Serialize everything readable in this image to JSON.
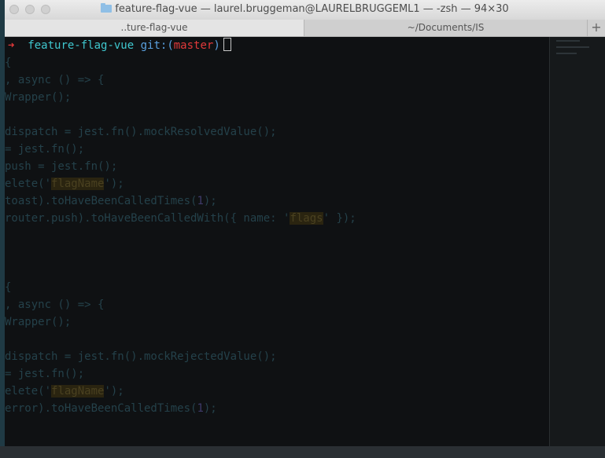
{
  "window": {
    "title": "feature-flag-vue — laurel.bruggeman@LAURELBRUGGEML1 — -zsh — 94×30",
    "tabs": [
      {
        "label": "..ture-flag-vue",
        "active": true
      },
      {
        "label": "~/Documents/IS",
        "active": false
      }
    ],
    "add_tab": "+"
  },
  "prompt": {
    "arrow": "➜",
    "directory": "feature-flag-vue",
    "git_label": "git:",
    "open_paren": "(",
    "branch": "master",
    "close_paren": ")"
  },
  "background_code": [
    [
      "{"
    ],
    [
      ", async () => {"
    ],
    [
      "Wrapper();"
    ],
    [
      ""
    ],
    [
      "dispatch = jest.fn().mockResolvedValue();"
    ],
    [
      "= jest.fn();"
    ],
    [
      "push = jest.fn();"
    ],
    [
      "elete('",
      "flagName",
      "');"
    ],
    [
      "toast).toHaveBeenCalledTimes(",
      "1",
      ");"
    ],
    [
      "router.push).toHaveBeenCalledWith({ name: '",
      "flags",
      "' });"
    ],
    [
      ""
    ],
    [
      ""
    ],
    [
      ""
    ],
    [
      "{"
    ],
    [
      ", async () => {"
    ],
    [
      "Wrapper();"
    ],
    [
      ""
    ],
    [
      "dispatch = jest.fn().mockRejectedValue();"
    ],
    [
      "= jest.fn();"
    ],
    [
      "elete('",
      "flagName",
      "');"
    ],
    [
      "error).toHaveBeenCalledTimes(",
      "1",
      ");"
    ]
  ],
  "colors": {
    "prompt_arrow": "#e2393a",
    "directory": "#3fc7ce",
    "git": "#5aa1e0",
    "branch": "#e2393a",
    "terminal_bg": "#0f1113"
  }
}
